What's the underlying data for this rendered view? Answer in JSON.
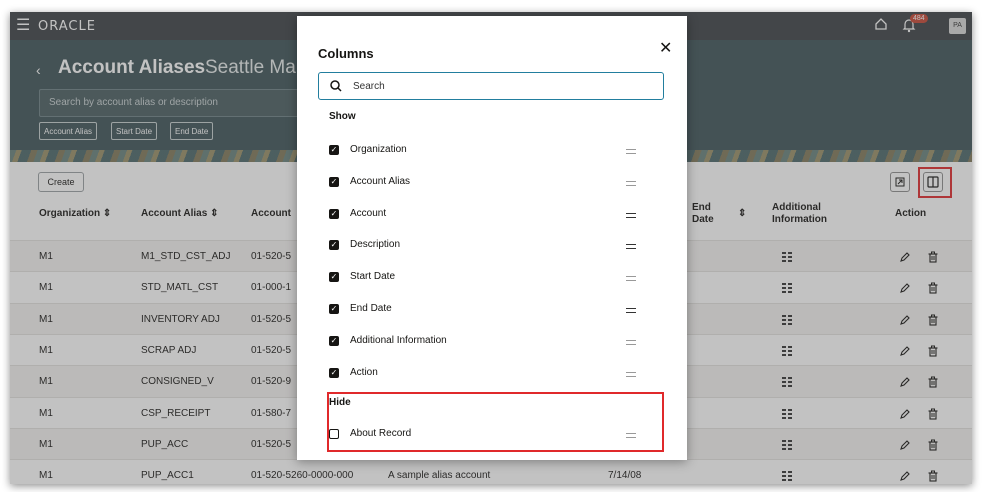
{
  "topbar": {
    "logo": "ORACLE",
    "notification_count": "484",
    "avatar": "PA"
  },
  "header": {
    "title": "Account Aliases",
    "subtitle": "Seattle Mar",
    "search_placeholder": "Search by account alias or description",
    "filters": [
      "Account Alias",
      "Start Date",
      "End Date"
    ]
  },
  "toolbar": {
    "create_label": "Create"
  },
  "table": {
    "headers": {
      "organization": "Organization",
      "account_alias": "Account Alias",
      "account": "Account",
      "end_date": "End Date",
      "additional_information": "Additional Information",
      "action": "Action"
    },
    "rows": [
      {
        "org": "M1",
        "alias": "M1_STD_CST_ADJ",
        "account": "01-520-5"
      },
      {
        "org": "M1",
        "alias": "STD_MATL_CST",
        "account": "01-000-1"
      },
      {
        "org": "M1",
        "alias": "INVENTORY ADJ",
        "account": "01-520-5"
      },
      {
        "org": "M1",
        "alias": "SCRAP ADJ",
        "account": "01-520-5"
      },
      {
        "org": "M1",
        "alias": "CONSIGNED_V",
        "account": "01-520-9"
      },
      {
        "org": "M1",
        "alias": "CSP_RECEIPT",
        "account": "01-580-7"
      },
      {
        "org": "M1",
        "alias": "PUP_ACC",
        "account": "01-520-5"
      },
      {
        "org": "M1",
        "alias": "PUP_ACC1",
        "account": "01-520-5260-0000-000",
        "description": "A sample alias account",
        "date": "7/14/08"
      }
    ]
  },
  "dialog": {
    "title": "Columns",
    "search_placeholder": "Search",
    "show_label": "Show",
    "show_items": [
      "Organization",
      "Account Alias",
      "Account",
      "Description",
      "Start Date",
      "End Date",
      "Additional Information",
      "Action"
    ],
    "hide_label": "Hide",
    "hide_items": [
      "About Record"
    ]
  },
  "colors": {
    "header_bg": "#3e5458",
    "topbar_bg": "#3d4145",
    "highlight": "#e0292b",
    "focus": "#227e9e"
  }
}
